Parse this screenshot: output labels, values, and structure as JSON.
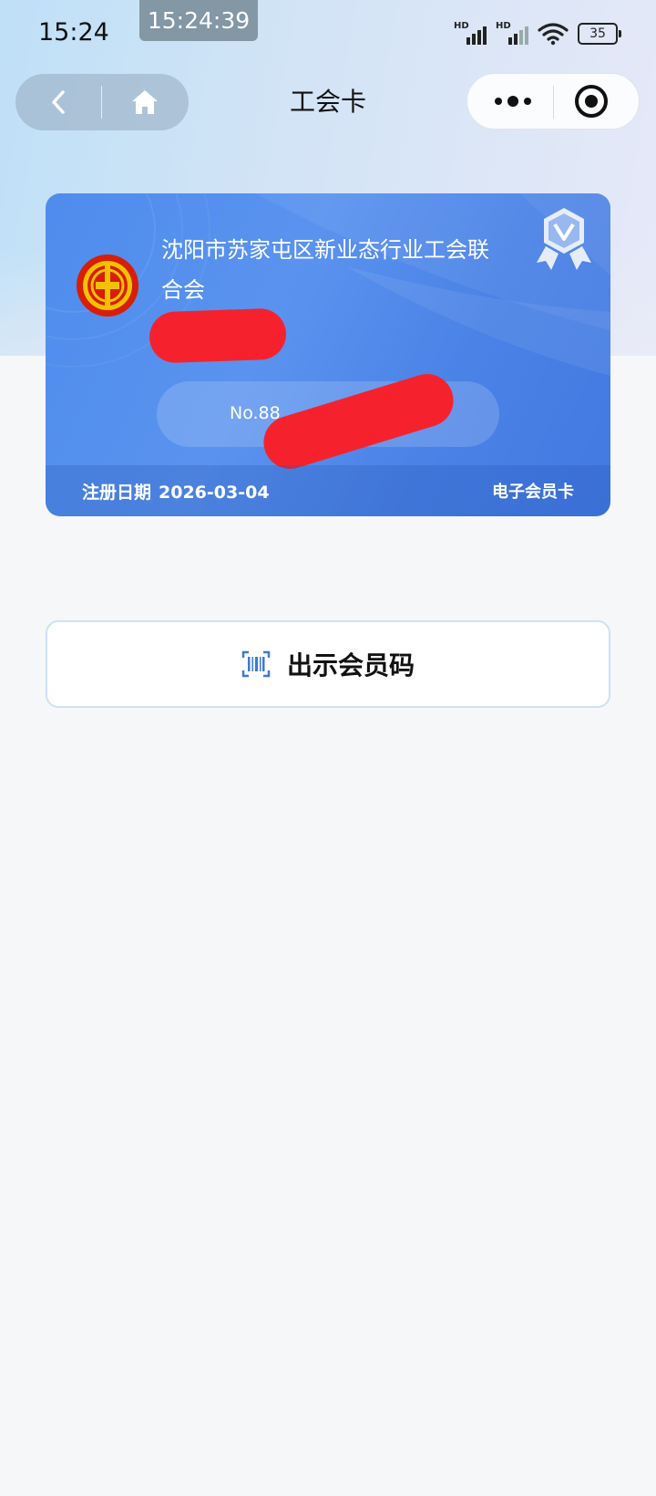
{
  "status_bar": {
    "time": "15:24",
    "clock_overlay": "15:24:39",
    "signal1_label": "HD",
    "signal2_label": "HD",
    "battery": "35"
  },
  "nav": {
    "title": "工会卡",
    "back_icon": "chevron-left-icon",
    "home_icon": "home-icon",
    "more_icon": "more-dots-icon",
    "close_icon": "target-close-icon"
  },
  "card": {
    "org_name": "沈阳市苏家屯区新业态行业工会联合会",
    "member_no": "No.88",
    "register_label": "注册日期",
    "register_date": "2026-03-04",
    "card_type": "电子会员卡",
    "logo_icon": "trade-union-emblem-icon",
    "badge_icon": "verified-v-badge-icon",
    "bg_color": "#4f8cec"
  },
  "actions": {
    "show_code_label": "出示会员码",
    "show_code_icon": "barcode-scan-icon"
  }
}
